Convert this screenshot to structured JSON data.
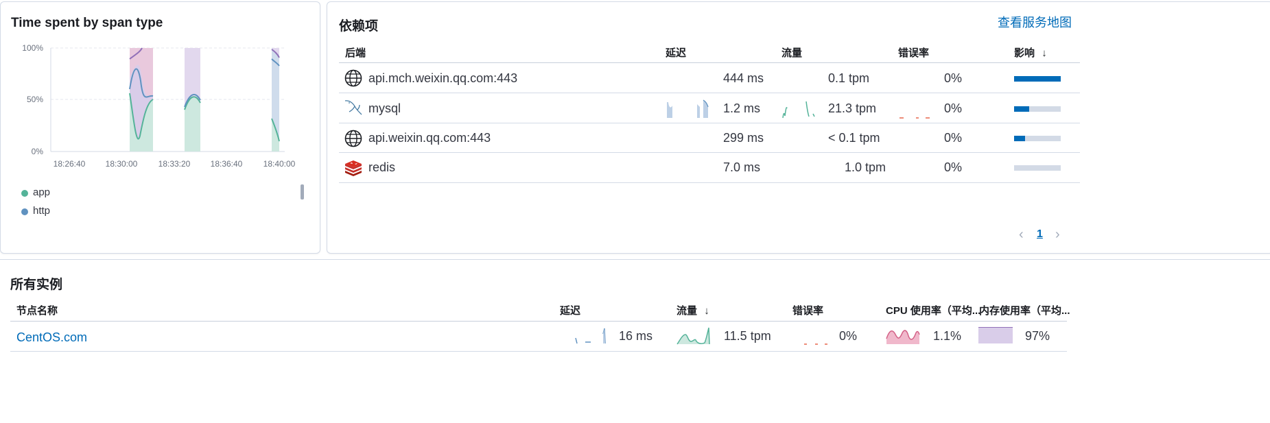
{
  "span_panel": {
    "title": "Time spent by span type",
    "legend": [
      {
        "label": "app",
        "color": "#54b399"
      },
      {
        "label": "http",
        "color": "#6092c0"
      }
    ]
  },
  "chart_data": {
    "type": "area",
    "title": "Time spent by span type",
    "stacked": true,
    "y_ticks": [
      "100%",
      "50%",
      "0%"
    ],
    "x_ticks": [
      "18:26:40",
      "18:30:00",
      "18:33:20",
      "18:36:40",
      "18:40:00"
    ],
    "ylim": [
      0,
      100
    ],
    "grid": true,
    "series": [
      {
        "name": "app",
        "color": "#54b399",
        "segments": [
          [
            [
              "18:30:00",
              55
            ],
            [
              "18:31:00",
              15
            ],
            [
              "18:31:40",
              48
            ],
            [
              "18:32:20",
              52
            ]
          ],
          [
            [
              "18:33:20",
              42
            ],
            [
              "18:34:00",
              52
            ],
            [
              "18:34:40",
              48
            ]
          ],
          [
            [
              "18:40:00",
              32
            ],
            [
              "18:40:40",
              10
            ]
          ]
        ]
      },
      {
        "name": "http",
        "color": "#6092c0",
        "segments": [
          [
            [
              "18:30:00",
              60
            ],
            [
              "18:31:00",
              80
            ],
            [
              "18:31:40",
              48
            ],
            [
              "18:32:20",
              55
            ]
          ],
          [
            [
              "18:33:20",
              42
            ],
            [
              "18:34:00",
              55
            ],
            [
              "18:34:40",
              48
            ]
          ],
          [
            [
              "18:40:00",
              90
            ],
            [
              "18:40:40",
              85
            ]
          ]
        ]
      }
    ]
  },
  "deps_panel": {
    "title": "依赖项",
    "service_map_link": "查看服务地图",
    "columns": [
      "后端",
      "延迟",
      "流量",
      "错误率",
      "影响"
    ],
    "rows": [
      {
        "icon": "globe-icon",
        "name": "api.mch.weixin.qq.com:443",
        "latency": "444 ms",
        "throughput": "0.1 tpm",
        "error_rate": "0%",
        "impact": 1.0
      },
      {
        "icon": "mysql-icon",
        "name": "mysql",
        "latency": "1.2 ms",
        "throughput": "21.3 tpm",
        "error_rate": "0%",
        "impact": 0.33
      },
      {
        "icon": "globe-icon",
        "name": "api.weixin.qq.com:443",
        "latency": "299 ms",
        "throughput": "< 0.1 tpm",
        "error_rate": "0%",
        "impact": 0.24
      },
      {
        "icon": "redis-icon",
        "name": "redis",
        "latency": "7.0 ms",
        "throughput": "1.0 tpm",
        "error_rate": "0%",
        "impact": 0.0
      }
    ],
    "page": "1"
  },
  "instances_panel": {
    "title": "所有实例",
    "columns": [
      "节点名称",
      "延迟",
      "流量",
      "错误率",
      "CPU 使用率（平均...",
      "内存使用率（平均..."
    ],
    "rows": [
      {
        "name": "CentOS.com",
        "latency": "16 ms",
        "throughput": "11.5 tpm",
        "error_rate": "0%",
        "cpu": "1.1%",
        "memory": "97%"
      }
    ]
  },
  "colors": {
    "accent": "#006bb8",
    "app": "#54b399",
    "http": "#6092c0",
    "cpu": "#d36086",
    "memory": "#9170b8",
    "error": "#e7664c"
  }
}
